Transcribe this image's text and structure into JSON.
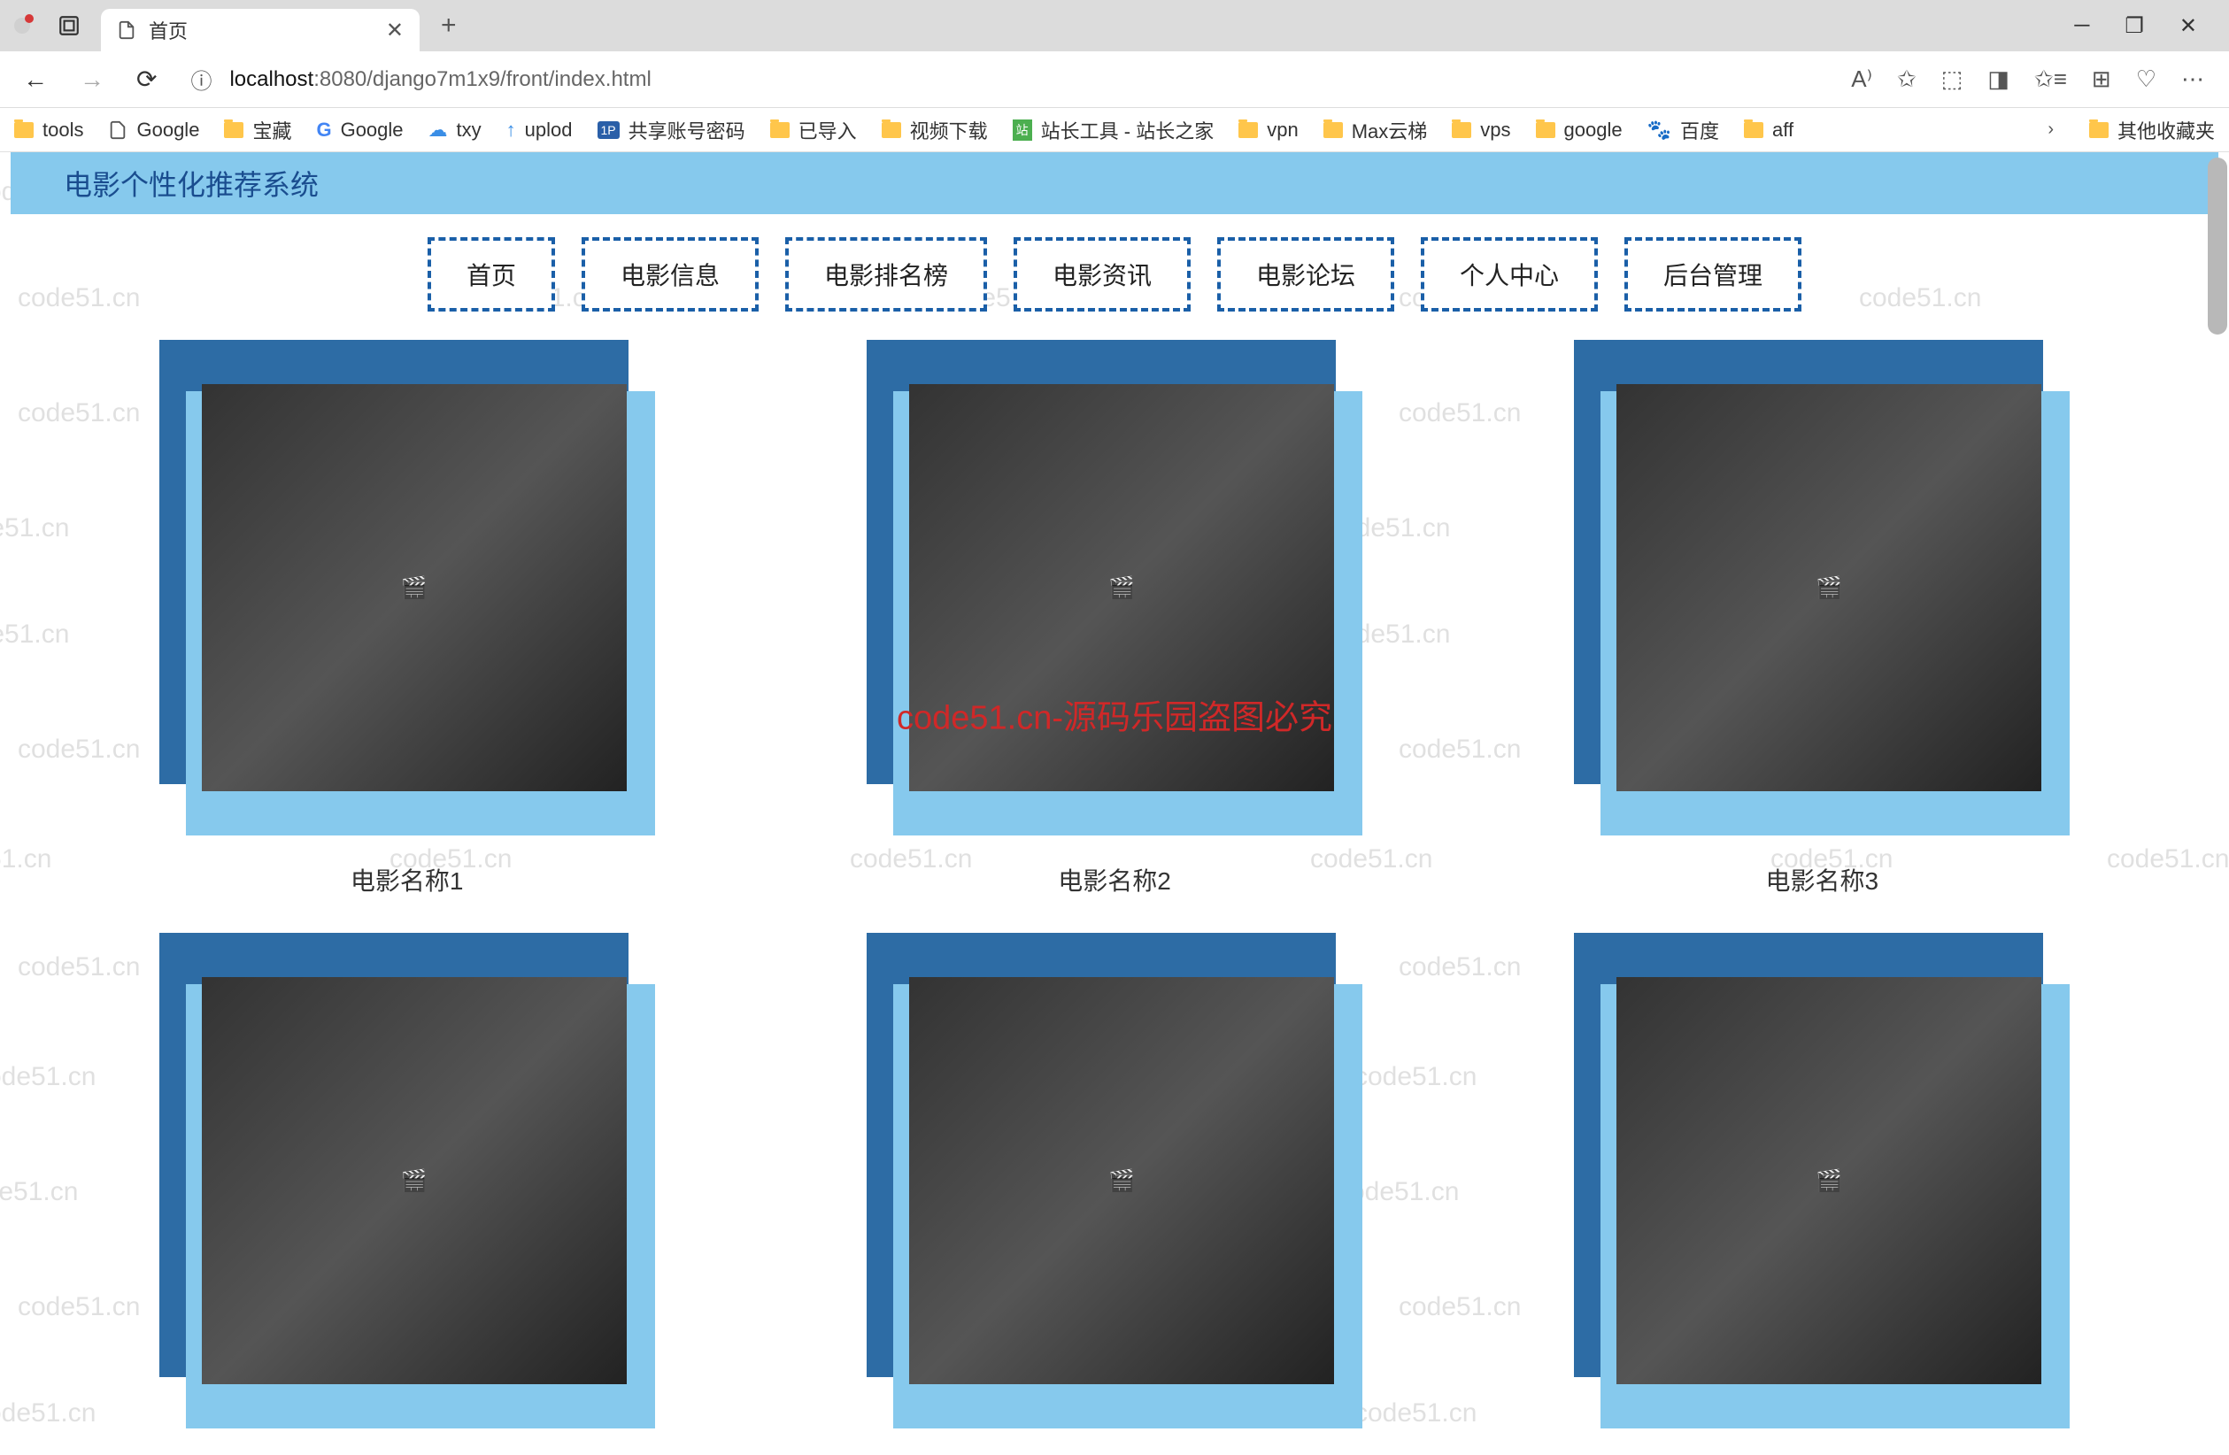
{
  "browser": {
    "tab_title": "首页",
    "url_host": "localhost",
    "url_path": ":8080/django7m1x9/front/index.html",
    "bookmarks": [
      {
        "label": "tools",
        "icon": "folder"
      },
      {
        "label": "Google",
        "icon": "page"
      },
      {
        "label": "宝藏",
        "icon": "folder"
      },
      {
        "label": "Google",
        "icon": "g"
      },
      {
        "label": "txy",
        "icon": "cloud"
      },
      {
        "label": "uplod",
        "icon": "up"
      },
      {
        "label": "共享账号密码",
        "icon": "1p"
      },
      {
        "label": "已导入",
        "icon": "folder"
      },
      {
        "label": "视频下载",
        "icon": "folder"
      },
      {
        "label": "站长工具 - 站长之家",
        "icon": "zz"
      },
      {
        "label": "vpn",
        "icon": "folder"
      },
      {
        "label": "Max云梯",
        "icon": "folder"
      },
      {
        "label": "vps",
        "icon": "folder"
      },
      {
        "label": "google",
        "icon": "folder"
      },
      {
        "label": "百度",
        "icon": "baidu"
      },
      {
        "label": "aff",
        "icon": "folder"
      }
    ],
    "bookmark_overflow": "其他收藏夹"
  },
  "page": {
    "header_title": "电影个性化推荐系统",
    "nav": [
      "首页",
      "电影信息",
      "电影排名榜",
      "电影资讯",
      "电影论坛",
      "个人中心",
      "后台管理"
    ],
    "movies": [
      {
        "title": "电影名称1"
      },
      {
        "title": "电影名称2"
      },
      {
        "title": "电影名称3"
      },
      {
        "title": ""
      },
      {
        "title": ""
      },
      {
        "title": ""
      }
    ]
  },
  "watermark": {
    "text": "code51.cn",
    "center": "code51.cn-源码乐园盗图必究"
  }
}
